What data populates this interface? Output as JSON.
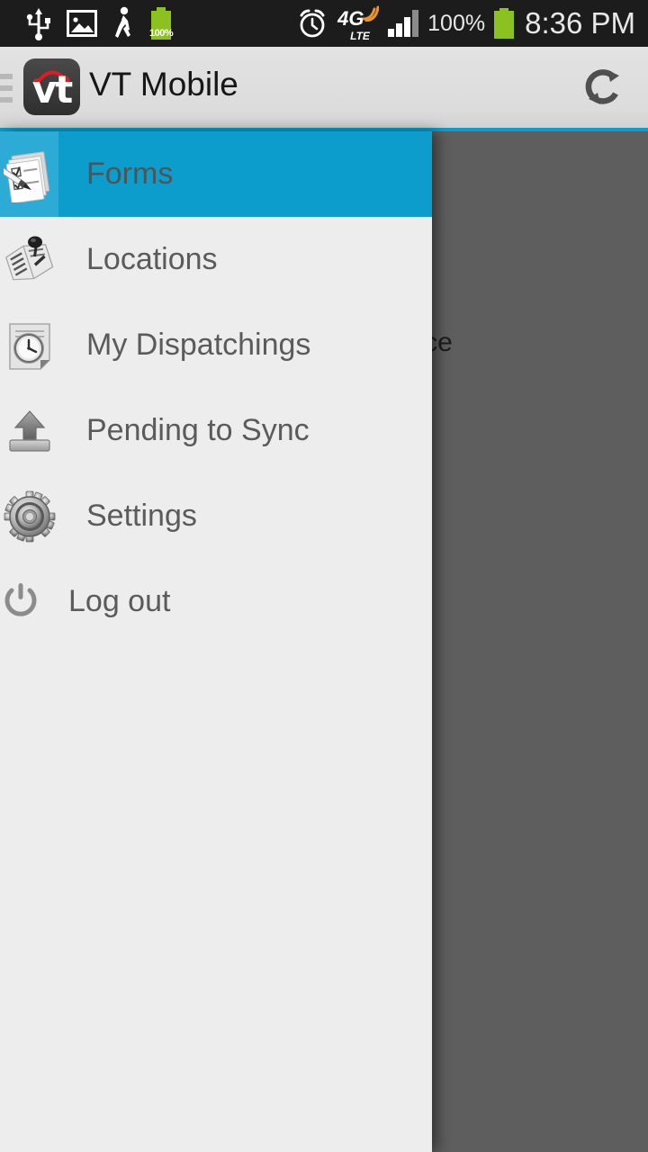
{
  "status_bar": {
    "left_icons": [
      {
        "name": "usb-icon",
        "glyph": "usb"
      },
      {
        "name": "image-icon",
        "glyph": "picture"
      },
      {
        "name": "pedometer-icon",
        "glyph": "walking-person"
      },
      {
        "name": "battery-percent-icon",
        "glyph": "battery",
        "value": "100%"
      }
    ],
    "right_icons": [
      {
        "name": "alarm-icon",
        "glyph": "alarm-clock"
      },
      {
        "name": "network-type-icon",
        "glyph": "4G LTE",
        "primary": "4G",
        "secondary": "LTE"
      },
      {
        "name": "signal-bars-icon",
        "glyph": "signal",
        "bars_on": 3,
        "bars_total": 4
      }
    ],
    "battery_percent": "100%",
    "time": "8:36 PM"
  },
  "app_bar": {
    "menu_icon": "hamburger-icon",
    "logo_text": "vt",
    "title": "VT Mobile",
    "refresh_icon": "refresh-icon"
  },
  "drawer": {
    "items": [
      {
        "label": "Forms",
        "icon": "forms-icon",
        "active": true
      },
      {
        "label": "Locations",
        "icon": "locations-map-pin-icon",
        "active": false
      },
      {
        "label": "My Dispatchings",
        "icon": "dispatch-clock-document-icon",
        "active": false
      },
      {
        "label": "Pending to Sync",
        "icon": "upload-arrow-icon",
        "active": false
      },
      {
        "label": "Settings",
        "icon": "gear-icon",
        "active": false
      },
      {
        "label": "Log out",
        "icon": "power-icon",
        "active": false
      }
    ]
  },
  "background": {
    "visible_row_text": "aintenance"
  },
  "colors": {
    "accent": "#0d9dcd",
    "accent_icon_cell": "#2babd6",
    "drawer_bg": "#ededed",
    "app_bar_bg": "#dedede",
    "scrim": "#5e5e5e",
    "status_bar_bg": "#1c1c1c",
    "battery_green": "#8bc220",
    "logo_red": "#e01b22"
  }
}
